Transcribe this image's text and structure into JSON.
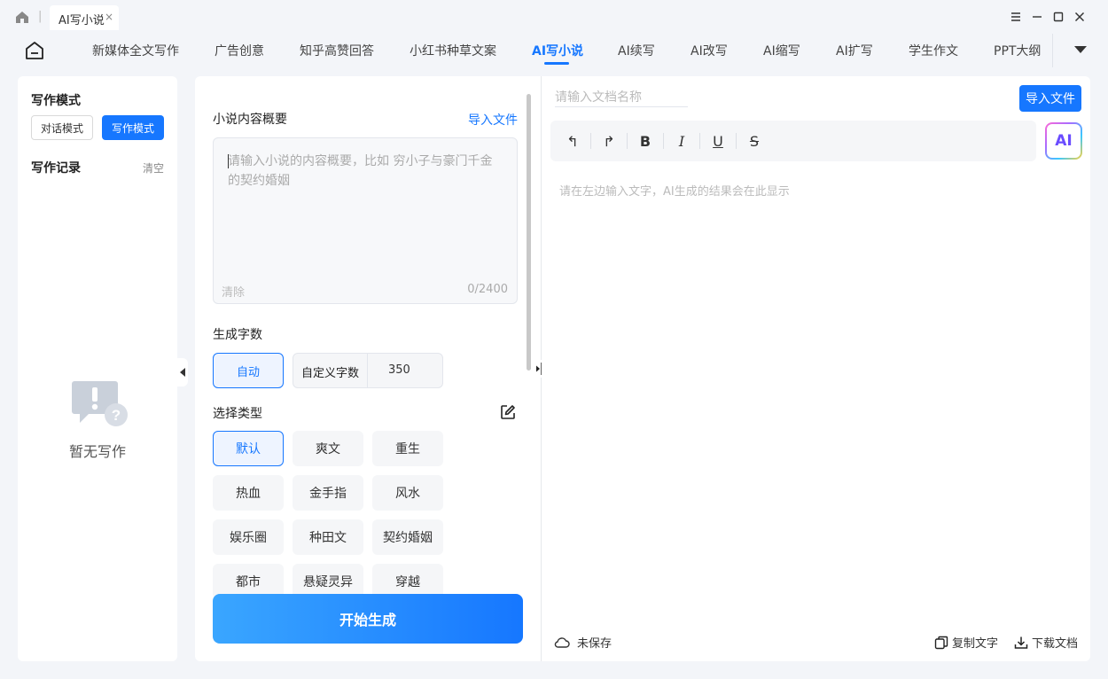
{
  "titlebar": {
    "tab_label": "AI写小说",
    "tab_close": "×"
  },
  "topnav": {
    "items": [
      "新媒体全文写作",
      "广告创意",
      "知乎高赞回答",
      "小红书种草文案",
      "AI写小说",
      "AI续写",
      "AI改写",
      "AI缩写",
      "AI扩写",
      "学生作文",
      "PPT大纲"
    ],
    "active_index": 4
  },
  "left": {
    "mode_title": "写作模式",
    "mode_chat": "对话模式",
    "mode_write": "写作模式",
    "record_title": "写作记录",
    "clear": "清空",
    "empty_text": "暂无写作"
  },
  "middle": {
    "summary_label": "小说内容概要",
    "import_label": "导入文件",
    "summary_placeholder": "请输入小说的内容概要，比如 穷小子与豪门千金的契约婚姻",
    "summary_clear": "清除",
    "summary_count": "0/2400",
    "wordcount_label": "生成字数",
    "auto_label": "自动",
    "custom_label": "自定义字数",
    "custom_value": "350",
    "type_label": "选择类型",
    "genres": [
      "默认",
      "爽文",
      "重生",
      "热血",
      "金手指",
      "风水",
      "娱乐圈",
      "种田文",
      "契约婚姻",
      "都市",
      "悬疑灵异",
      "穿越"
    ],
    "selected_genre": "默认",
    "start_label": "开始生成"
  },
  "right": {
    "doc_name_placeholder": "请输入文档名称",
    "import_label": "导入文件",
    "toolbar": {
      "undo": "↰",
      "redo": "↱",
      "bold": "B",
      "italic": "I",
      "underline": "U",
      "strike": "S"
    },
    "ai_label": "AI",
    "editor_placeholder": "请在左边输入文字，AI生成的结果会在此显示",
    "save_status": "未保存",
    "copy_label": "复制文字",
    "download_label": "下载文档"
  },
  "colors": {
    "accent": "#1677ff",
    "background": "#f3f5f9"
  }
}
